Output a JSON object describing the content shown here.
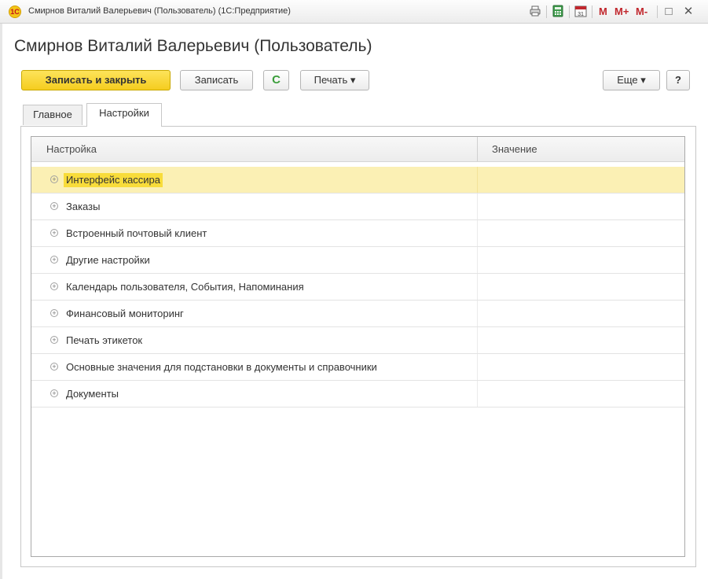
{
  "window": {
    "title": "Смирнов Виталий Валерьевич (Пользователь) (1С:Предприятие)",
    "logo_text": "1С",
    "icons": [
      "printer-icon",
      "calculator-icon",
      "calendar-icon"
    ],
    "memory_buttons": [
      "M",
      "M+",
      "M-"
    ],
    "maximize_glyph": "□",
    "close_glyph": "✕"
  },
  "form": {
    "title": "Смирнов Виталий Валерьевич (Пользователь)"
  },
  "toolbar": {
    "save_close_label": "Записать и закрыть",
    "save_label": "Записать",
    "refresh_glyph": "C",
    "print_label": "Печать ▾",
    "more_label": "Еще ▾",
    "help_label": "?"
  },
  "tabs": [
    {
      "label": "Главное",
      "active": false
    },
    {
      "label": "Настройки",
      "active": true
    }
  ],
  "grid": {
    "columns": [
      "Настройка",
      "Значение"
    ],
    "rows": [
      {
        "label": "Интерфейс кассира",
        "value": "",
        "selected": true
      },
      {
        "label": "Заказы",
        "value": ""
      },
      {
        "label": "Встроенный почтовый клиент",
        "value": ""
      },
      {
        "label": "Другие настройки",
        "value": ""
      },
      {
        "label": "Календарь пользователя, События, Напоминания",
        "value": ""
      },
      {
        "label": "Финансовый мониторинг",
        "value": ""
      },
      {
        "label": "Печать этикеток",
        "value": ""
      },
      {
        "label": "Основные значения для подстановки в документы и справочники",
        "value": ""
      },
      {
        "label": "Документы",
        "value": ""
      }
    ]
  },
  "colors": {
    "primary_button": "#f5cd1f",
    "selected_row": "#fbf0b4",
    "memory_buttons": "#c1272d"
  }
}
